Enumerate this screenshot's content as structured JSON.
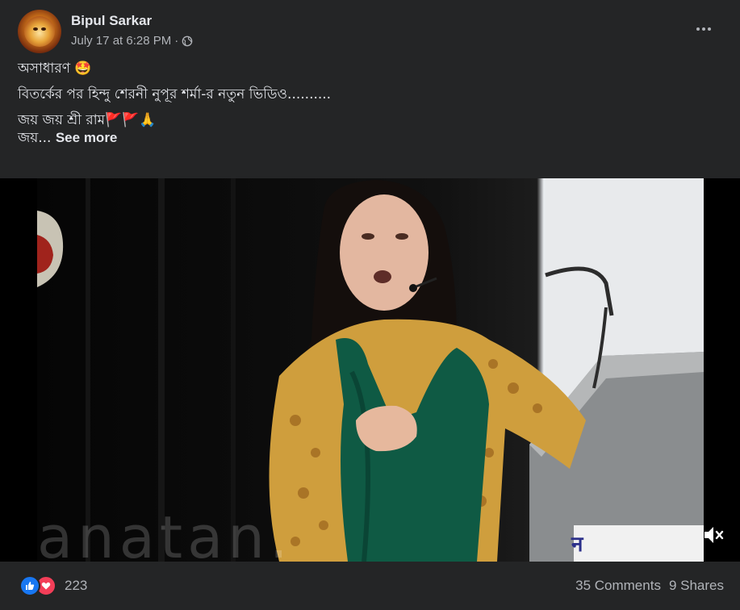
{
  "post": {
    "author": "Bipul Sarkar",
    "timestamp": "July 17 at 6:28 PM",
    "separator": "·",
    "privacy_icon": "globe-icon",
    "more_icon": "more-horizontal-icon",
    "lines": [
      "অসাধারণ 🤩",
      "বিতর্কের পর হিন্দু শেরনী নুপূর শর্মা-র নতুন ভিডিও..........",
      "জয় জয় শ্রী রাম🚩🚩🙏",
      "জয়..."
    ],
    "see_more": "See more"
  },
  "video": {
    "mute_icon": "volume-muted-icon"
  },
  "footer": {
    "reaction_icons": [
      "like-icon",
      "love-icon"
    ],
    "reaction_count": "223",
    "comments": "35 Comments",
    "shares": "9 Shares"
  },
  "colors": {
    "background": "#242526",
    "text_primary": "#e4e6eb",
    "text_secondary": "#b0b3b8",
    "like_blue": "#1877f2",
    "love_red": "#f33e58"
  }
}
